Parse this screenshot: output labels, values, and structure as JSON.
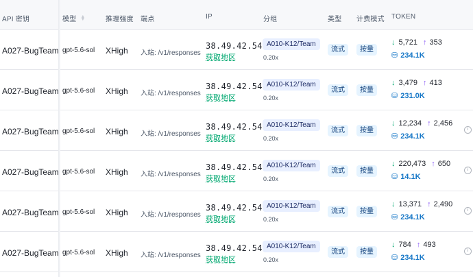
{
  "header": {
    "api_key": "API 密钥",
    "model": "模型",
    "reasoning": "推理强度",
    "endpoint": "端点",
    "ip": "IP",
    "group": "分组",
    "type": "类型",
    "billing": "计费模式",
    "token": "TOKEN"
  },
  "rows": [
    {
      "key": "A027-BugTeam",
      "model": "gpt-5.6-sol",
      "effort": "XHigh",
      "endpoint": "入站: /v1/responses",
      "ip": "38.49.42.54",
      "region": "获取地区",
      "group": "A010-K12/Team",
      "ratio": "0.20x",
      "type": "流式",
      "billing": "按量",
      "input": "5,721",
      "output": "353",
      "cache": "234.1K"
    },
    {
      "key": "A027-BugTeam",
      "model": "gpt-5.6-sol",
      "effort": "XHigh",
      "endpoint": "入站: /v1/responses",
      "ip": "38.49.42.54",
      "region": "获取地区",
      "group": "A010-K12/Team",
      "ratio": "0.20x",
      "type": "流式",
      "billing": "按量",
      "input": "3,479",
      "output": "413",
      "cache": "231.0K"
    },
    {
      "key": "A027-BugTeam",
      "model": "gpt-5.6-sol",
      "effort": "XHigh",
      "endpoint": "入站: /v1/responses",
      "ip": "38.49.42.54",
      "region": "获取地区",
      "group": "A010-K12/Team",
      "ratio": "0.20x",
      "type": "流式",
      "billing": "按量",
      "input": "12,234",
      "output": "2,456",
      "cache": "234.1K"
    },
    {
      "key": "A027-BugTeam",
      "model": "gpt-5.6-sol",
      "effort": "XHigh",
      "endpoint": "入站: /v1/responses",
      "ip": "38.49.42.54",
      "region": "获取地区",
      "group": "A010-K12/Team",
      "ratio": "0.20x",
      "type": "流式",
      "billing": "按量",
      "input": "220,473",
      "output": "650",
      "cache": "14.1K"
    },
    {
      "key": "A027-BugTeam",
      "model": "gpt-5.6-sol",
      "effort": "XHigh",
      "endpoint": "入站: /v1/responses",
      "ip": "38.49.42.54",
      "region": "获取地区",
      "group": "A010-K12/Team",
      "ratio": "0.20x",
      "type": "流式",
      "billing": "按量",
      "input": "13,371",
      "output": "2,490",
      "cache": "234.1K"
    },
    {
      "key": "A027-BugTeam",
      "model": "gpt-5.6-sol",
      "effort": "XHigh",
      "endpoint": "入站: /v1/responses",
      "ip": "38.49.42.54",
      "region": "获取地区",
      "group": "A010-K12/Team",
      "ratio": "0.20x",
      "type": "流式",
      "billing": "按量",
      "input": "784",
      "output": "493",
      "cache": "234.1K"
    }
  ],
  "icons": {
    "sort": "sort-icon",
    "input_tokens": "arrow-down-icon",
    "output_tokens": "arrow-up-icon",
    "cache_tokens": "cache-icon",
    "info": "info-icon"
  },
  "colors": {
    "region_link": "#00a870",
    "group_tag_bg": "#e8efff",
    "type_tag_bg": "#e6f4ff",
    "input_arrow": "#00a870",
    "output_arrow": "#8b5cf6",
    "cache_value": "#1677c7"
  }
}
